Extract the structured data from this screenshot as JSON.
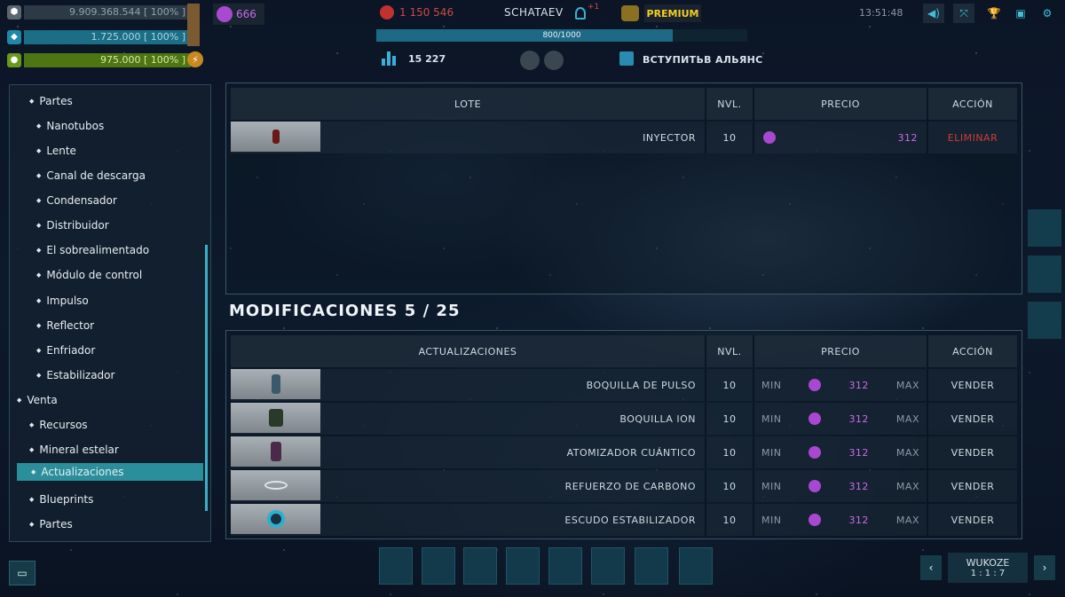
{
  "resources": [
    {
      "name": "metal",
      "value": "9.909.368.544",
      "pct": "[ 100% ]",
      "color": "#3a4a58",
      "icon": "hexagon-icon"
    },
    {
      "name": "crystal",
      "value": "1.725.000",
      "pct": "[ 100% ]",
      "color": "#1a6f8a",
      "icon": "crystal-icon"
    },
    {
      "name": "fuel",
      "value": "975.000",
      "pct": "[ 100% ]",
      "color": "#5a7a1a",
      "icon": "drop-icon"
    }
  ],
  "premium_currency": "666",
  "red_currency": "1 150 546",
  "player_name": "SCHATAEV",
  "rank_badge": "+1",
  "premium_label": "PREMIUM",
  "xp_bar": {
    "text": "800/1000",
    "fraction": 0.8
  },
  "stats_value": "15 227",
  "alliance_label": "ВСТУПИТЬВ АЛЬЯНС",
  "clock": "13:51:48",
  "sidebar": {
    "items": [
      "Partes",
      "Nanotubos",
      "Lente",
      "Canal de descarga",
      "Condensador",
      "Distribuidor",
      "El sobrealimentado",
      "Módulo de control",
      "Impulso",
      "Reflector",
      "Enfriador",
      "Estabilizador",
      "Venta",
      "Recursos",
      "Mineral estelar",
      "Actualizaciones",
      "Blueprints",
      "Partes"
    ]
  },
  "lot_table": {
    "headers": {
      "lote": "LOTE",
      "nvl": "NVL.",
      "precio": "PRECIO",
      "accion": "ACCIÓN"
    },
    "rows": [
      {
        "name": "INYECTOR",
        "level": "10",
        "price": "312",
        "action": "ELIMINAR"
      }
    ]
  },
  "mods_title": "MODIFICACIONES 5 / 25",
  "mods_table": {
    "headers": {
      "name": "ACTUALIZACIONES",
      "nvl": "NVL.",
      "precio": "PRECIO",
      "accion": "ACCIÓN"
    },
    "min_label": "MIN",
    "max_label": "MAX",
    "rows": [
      {
        "name": "BOQUILLA DE PULSO",
        "level": "10",
        "price": "312",
        "action": "VENDER"
      },
      {
        "name": "BOQUILLA ION",
        "level": "10",
        "price": "312",
        "action": "VENDER"
      },
      {
        "name": "ATOMIZADOR CUÁNTICO",
        "level": "10",
        "price": "312",
        "action": "VENDER"
      },
      {
        "name": "REFUERZO DE CARBONO",
        "level": "10",
        "price": "312",
        "action": "VENDER"
      },
      {
        "name": "ESCUDO ESTABILIZADOR",
        "level": "10",
        "price": "312",
        "action": "VENDER"
      }
    ]
  },
  "location": {
    "name": "WUKOZE",
    "coords": "1 : 1 : 7"
  }
}
